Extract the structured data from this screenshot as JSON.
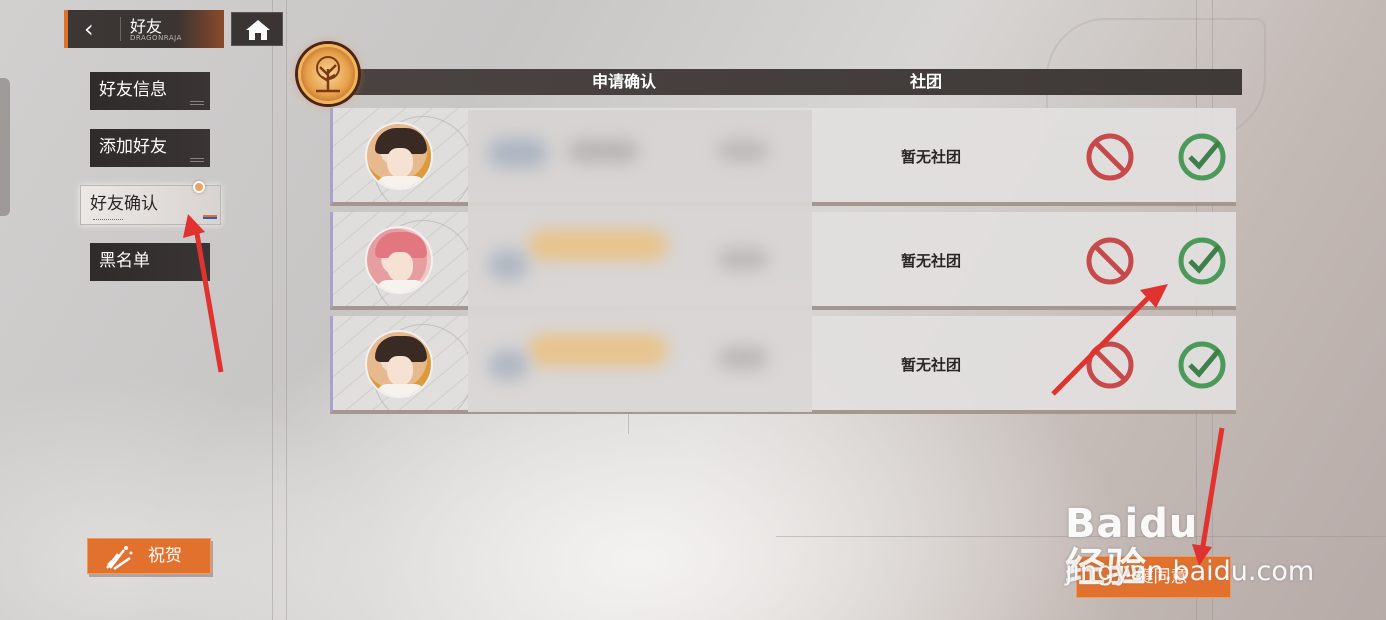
{
  "header": {
    "back_title": "好友",
    "back_subtitle": "DRAGONRAJA"
  },
  "menu": {
    "items": [
      {
        "label": "好友信息",
        "active": false
      },
      {
        "label": "添加好友",
        "active": false
      },
      {
        "label": "好友确认",
        "active": true
      },
      {
        "label": "黑名单",
        "active": false
      }
    ]
  },
  "table": {
    "columns": [
      "申请确认",
      "社团"
    ],
    "rows": [
      {
        "club": "暂无社团"
      },
      {
        "club": "暂无社团"
      },
      {
        "club": "暂无社团"
      }
    ]
  },
  "buttons": {
    "celebrate": "祝贺",
    "accept_all": "一键同意"
  },
  "watermark": {
    "main": "Baidu经验",
    "sub": "jingyan.baidu.com"
  },
  "colors": {
    "accent": "#e2712e",
    "header_bg": "#3f3937",
    "accept": "#4c9a5a",
    "reject": "#c74a4a",
    "arrow": "#e0322e"
  },
  "icons": {
    "back": "chevron-left-icon",
    "home": "home-icon",
    "emblem": "tree-icon",
    "reject": "reject-icon",
    "accept": "check-icon",
    "celebrate": "firework-icon"
  }
}
